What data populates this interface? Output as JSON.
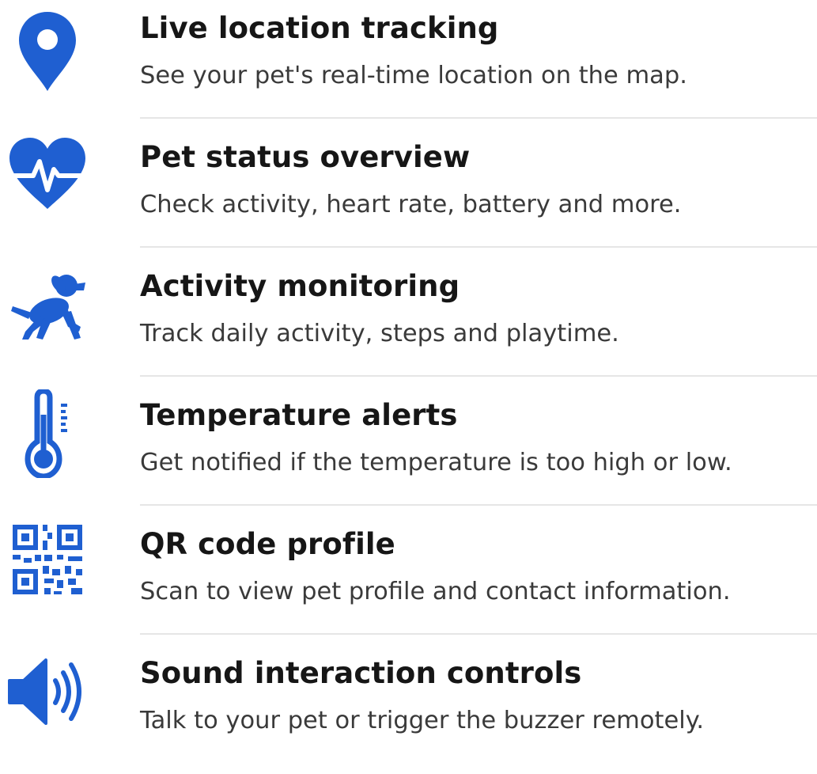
{
  "accent_color": "#1f5fd1",
  "features": [
    {
      "icon": "location-pin-icon",
      "title": "Live location tracking",
      "description": "See your pet's real-time location on the map."
    },
    {
      "icon": "heart-pulse-icon",
      "title": "Pet status overview",
      "description": "Check activity, heart rate, battery and more."
    },
    {
      "icon": "running-dog-icon",
      "title": "Activity monitoring",
      "description": "Track daily activity, steps and playtime."
    },
    {
      "icon": "thermometer-icon",
      "title": "Temperature alerts",
      "description": "Get notified if the temperature is too high or low."
    },
    {
      "icon": "qr-code-icon",
      "title": "QR code profile",
      "description": "Scan to view pet profile and contact information."
    },
    {
      "icon": "speaker-icon",
      "title": "Sound interaction controls",
      "description": "Talk to your pet or trigger the buzzer remotely."
    }
  ]
}
